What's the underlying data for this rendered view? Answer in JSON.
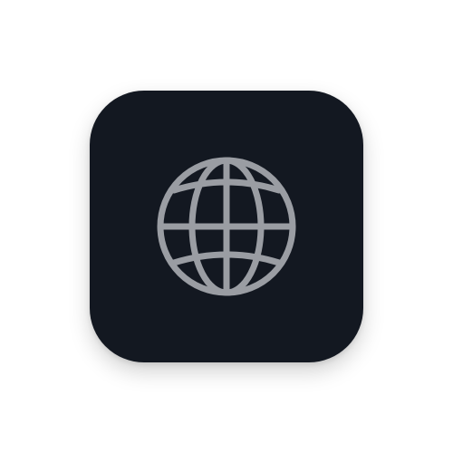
{
  "app_icon": {
    "icon": "globe-icon",
    "tile_color": "#131821",
    "glyph_color": "#9A9DA3",
    "background_color": "#FFFFFF"
  }
}
